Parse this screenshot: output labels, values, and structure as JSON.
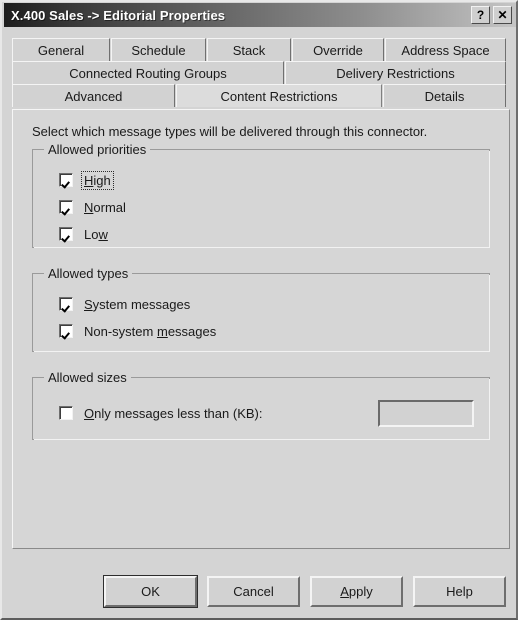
{
  "window": {
    "title": "X.400 Sales -> Editorial Properties",
    "help_button": "?",
    "close_button": "✕",
    "help_icon_name": "help-icon",
    "close_icon_name": "close-icon",
    "titlebar_gradient_from": "#1e1e1e",
    "titlebar_gradient_to": "#c6c6c6",
    "face_color": "#d4d4d4"
  },
  "tabs": {
    "rows": [
      [
        {
          "label": "General",
          "active": false
        },
        {
          "label": "Schedule",
          "active": false
        },
        {
          "label": "Stack",
          "active": false
        },
        {
          "label": "Override",
          "active": false
        },
        {
          "label": "Address Space",
          "active": false
        }
      ],
      [
        {
          "label": "Connected Routing Groups",
          "active": false
        },
        {
          "label": "Delivery Restrictions",
          "active": false
        }
      ],
      [
        {
          "label": "Advanced",
          "active": false
        },
        {
          "label": "Content Restrictions",
          "active": true
        },
        {
          "label": "Details",
          "active": false
        }
      ]
    ],
    "selected": "Content Restrictions"
  },
  "content": {
    "instruction": "Select which message types will be delivered through this connector.",
    "groups": [
      {
        "title": "Allowed priorities",
        "items": [
          {
            "label": "High",
            "accel_before": "",
            "accel": "H",
            "accel_after": "igh",
            "checked": true,
            "focused": true
          },
          {
            "label": "Normal",
            "accel_before": "",
            "accel": "N",
            "accel_after": "ormal",
            "checked": true,
            "focused": false
          },
          {
            "label": "Low",
            "accel_before": "Lo",
            "accel": "w",
            "accel_after": "",
            "checked": true,
            "focused": false
          }
        ]
      },
      {
        "title": "Allowed types",
        "items": [
          {
            "label": "System messages",
            "accel_before": "",
            "accel": "S",
            "accel_after": "ystem messages",
            "checked": true,
            "focused": false
          },
          {
            "label": "Non-system messages",
            "accel_before": "Non-system ",
            "accel": "m",
            "accel_after": "essages",
            "checked": true,
            "focused": false
          }
        ]
      },
      {
        "title": "Allowed sizes",
        "items": [
          {
            "label": "Only messages less than (KB):",
            "accel_before": "",
            "accel": "O",
            "accel_after": "nly messages less than (KB):",
            "checked": false,
            "focused": false
          }
        ],
        "input": {
          "value": "",
          "placeholder": "",
          "enabled": false
        }
      }
    ]
  },
  "footer": {
    "buttons": [
      {
        "label": "OK",
        "accel_before": "OK",
        "accel": "",
        "accel_after": "",
        "default": true
      },
      {
        "label": "Cancel",
        "accel_before": "Cancel",
        "accel": "",
        "accel_after": "",
        "default": false
      },
      {
        "label": "Apply",
        "accel_before": "",
        "accel": "A",
        "accel_after": "pply",
        "default": false
      },
      {
        "label": "Help",
        "accel_before": "Help",
        "accel": "",
        "accel_after": "",
        "default": false
      }
    ]
  }
}
